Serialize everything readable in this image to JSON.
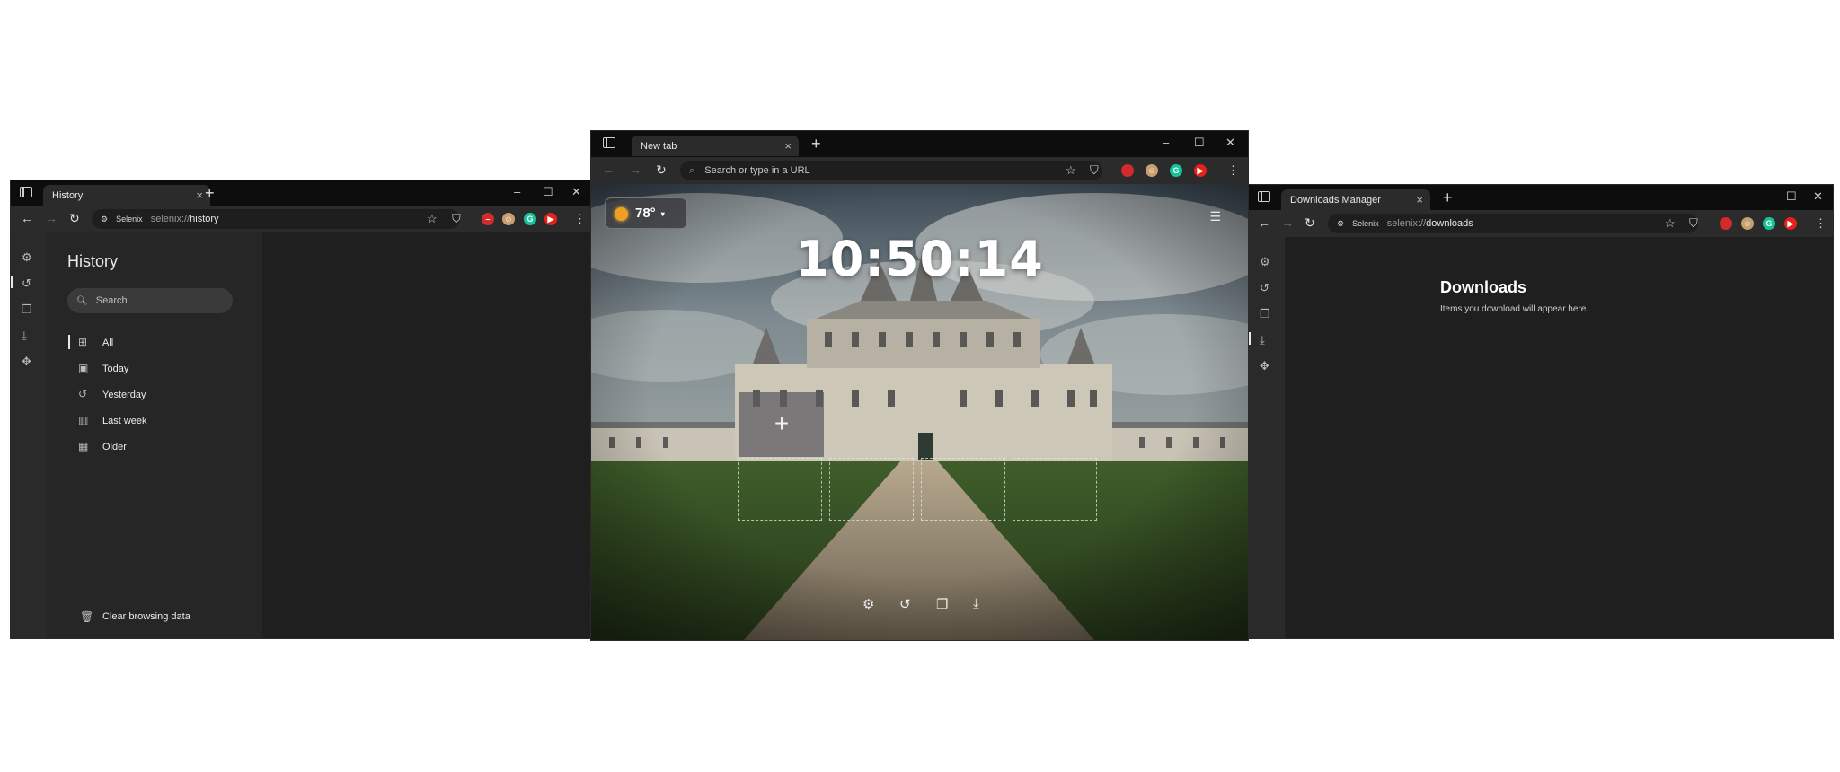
{
  "history_window": {
    "tab_title": "History",
    "omnibox": {
      "site": "Selenix",
      "scheme": "selenix://",
      "path": "history"
    },
    "page_title": "History",
    "search_placeholder": "Search",
    "filters": [
      {
        "label": "All",
        "icon": "grid-icon",
        "selected": true
      },
      {
        "label": "Today",
        "icon": "calendar-today-icon"
      },
      {
        "label": "Yesterday",
        "icon": "history-icon"
      },
      {
        "label": "Last week",
        "icon": "week-view-icon"
      },
      {
        "label": "Older",
        "icon": "calendar-icon"
      }
    ],
    "clear_label": "Clear browsing data"
  },
  "newtab_window": {
    "tab_title": "New tab",
    "omnibox_placeholder": "Search or type in a URL",
    "weather": {
      "temp": "78°",
      "icon": "sun-icon"
    },
    "clock": "10:50:14",
    "add_tile": "+",
    "dock_icons": [
      "gear-icon",
      "history-icon",
      "copy-icon",
      "download-icon"
    ]
  },
  "downloads_window": {
    "tab_title": "Downloads Manager",
    "omnibox": {
      "site": "Selenix",
      "scheme": "selenix://",
      "path": "downloads"
    },
    "page_title": "Downloads",
    "empty_message": "Items you download will appear here."
  },
  "extension_colors": {
    "block": "#d42a2a",
    "avatar": "#c8a070",
    "grammarly": "#15c39a",
    "youtube": "#e62117"
  }
}
